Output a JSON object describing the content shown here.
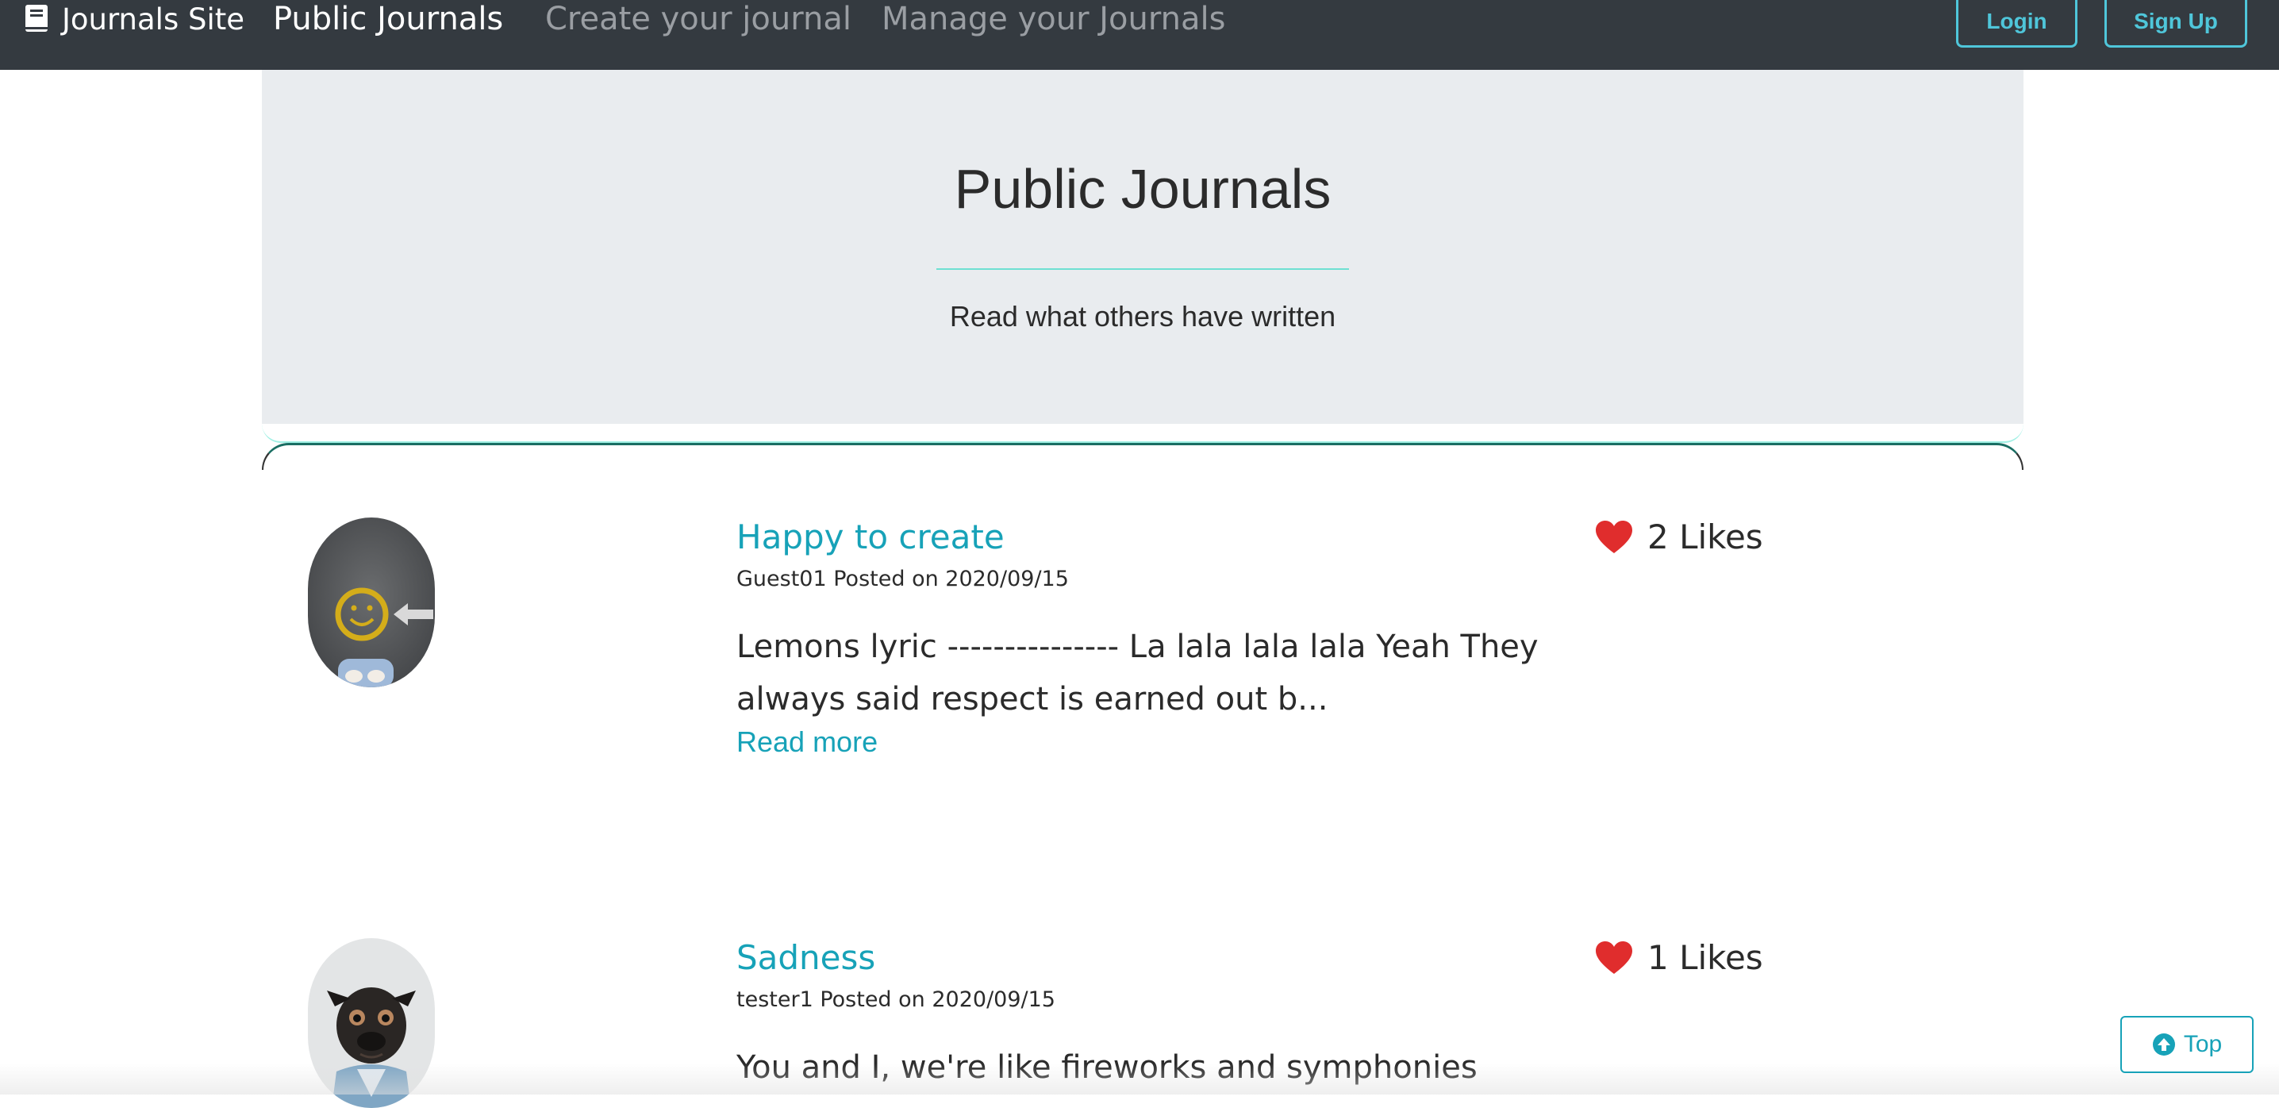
{
  "navbar": {
    "brand": "Journals Site",
    "brand_icon": "book-icon",
    "links": {
      "public": "Public Journals",
      "create": "Create your journal",
      "manage": "Manage your Journals"
    },
    "login_label": "Login",
    "signup_label": "Sign Up"
  },
  "hero": {
    "title": "Public Journals",
    "subtitle": "Read what others have written"
  },
  "posts": [
    {
      "title": "Happy to create",
      "meta": "Guest01 Posted on 2020/09/15",
      "excerpt": "Lemons lyric --------------- La lala lala lala Yeah They always said respect is earned out b...",
      "read_more": "Read more",
      "likes": "2 Likes",
      "avatar": "smiley-face-avatar"
    },
    {
      "title": "Sadness",
      "meta": "tester1 Posted on 2020/09/15",
      "excerpt": "You and I, we're like fireworks and symphonies",
      "likes": "1 Likes",
      "avatar": "pug-dog-avatar"
    }
  ],
  "top_button": {
    "label": "Top",
    "icon": "arrow-up-circle-icon"
  },
  "colors": {
    "navbar_bg": "#343a40",
    "accent": "#17a2b8",
    "nav_button": "#4fc6da",
    "heart": "#e02d2d",
    "hero_bg": "#e9ecef"
  }
}
